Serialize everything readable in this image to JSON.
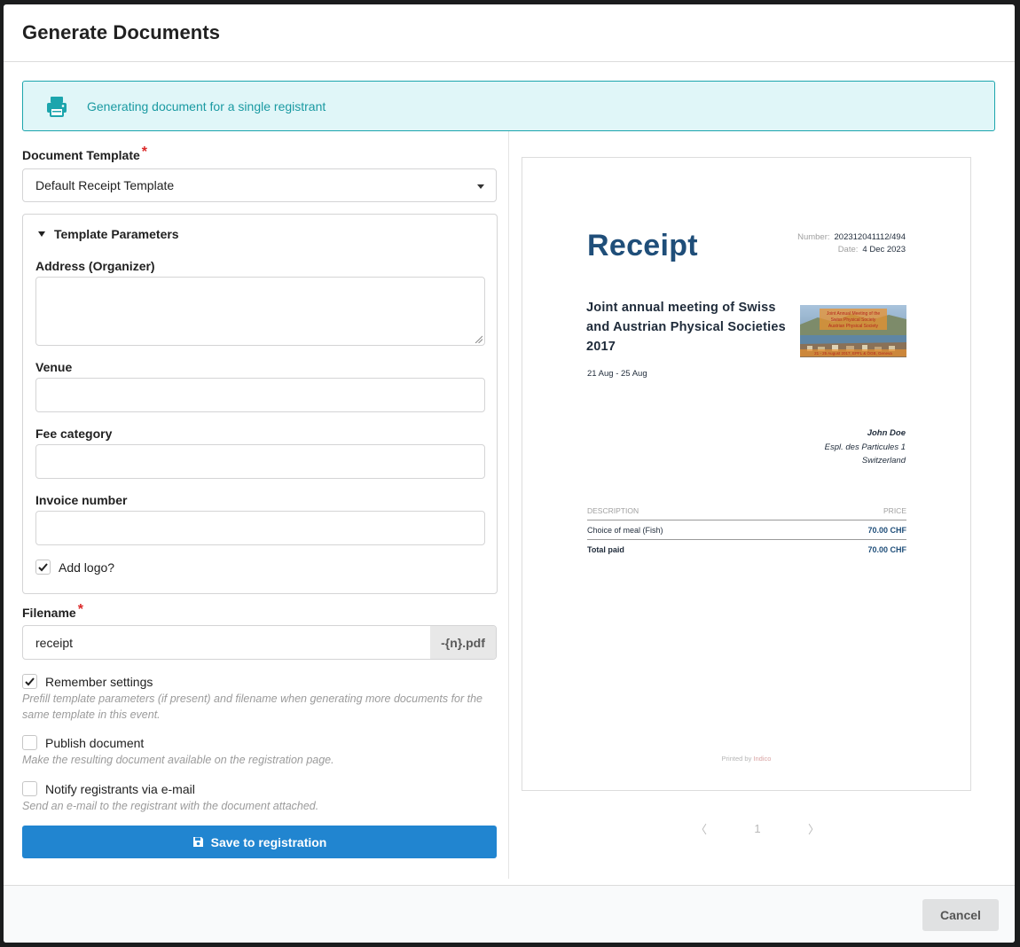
{
  "modal": {
    "title": "Generate Documents"
  },
  "info": {
    "text": "Generating document for a single registrant",
    "icon": "printer-icon",
    "color": "#1ca5ad"
  },
  "form": {
    "template_label": "Document Template",
    "template_value": "Default Receipt Template",
    "params_title": "Template Parameters",
    "fields": {
      "address_label": "Address (Organizer)",
      "address_value": "",
      "venue_label": "Venue",
      "venue_value": "",
      "fee_label": "Fee category",
      "fee_value": "",
      "invoice_label": "Invoice number",
      "invoice_value": ""
    },
    "add_logo_label": "Add logo?",
    "add_logo_checked": true,
    "filename_label": "Filename",
    "filename_value": "receipt",
    "filename_suffix": "-{n}.pdf",
    "remember_label": "Remember settings",
    "remember_checked": true,
    "remember_help": "Prefill template parameters (if present) and filename when generating more documents for the same template in this event.",
    "publish_label": "Publish document",
    "publish_checked": false,
    "publish_help": "Make the resulting document available on the registration page.",
    "notify_label": "Notify registrants via e-mail",
    "notify_checked": false,
    "notify_help": "Send an e-mail to the registrant with the document attached.",
    "save_label": "Save to registration",
    "save_color": "#2185d0"
  },
  "preview": {
    "title": "Receipt",
    "number_key": "Number:",
    "number_value": "202312041112/494",
    "date_key": "Date:",
    "date_value": "4 Dec 2023",
    "event_name": "Joint annual meeting of Swiss and Austrian Physical Societies 2017",
    "event_dates": "21 Aug - 25 Aug",
    "logo_lines": [
      "Joint Annual Meeting of the",
      "Swiss Physical Society",
      "Austrian Physical Society",
      "21 - 25 August 2017, EPFL & ÖGB, Geneva"
    ],
    "addr_name": "John Doe",
    "addr_line1": "Espl. des Particules 1",
    "addr_line2": "Switzerland",
    "col_desc": "DESCRIPTION",
    "col_price": "PRICE",
    "item_desc": "Choice of meal (Fish)",
    "item_price": "70.00 CHF",
    "total_label": "Total paid",
    "total_price": "70.00 CHF",
    "printed_prefix": "Printed by",
    "printed_brand": "Indico",
    "brand_color": "#1f4e79"
  },
  "pager": {
    "prev": "〈",
    "page": "1",
    "next": "〉"
  },
  "footer": {
    "cancel_label": "Cancel"
  }
}
